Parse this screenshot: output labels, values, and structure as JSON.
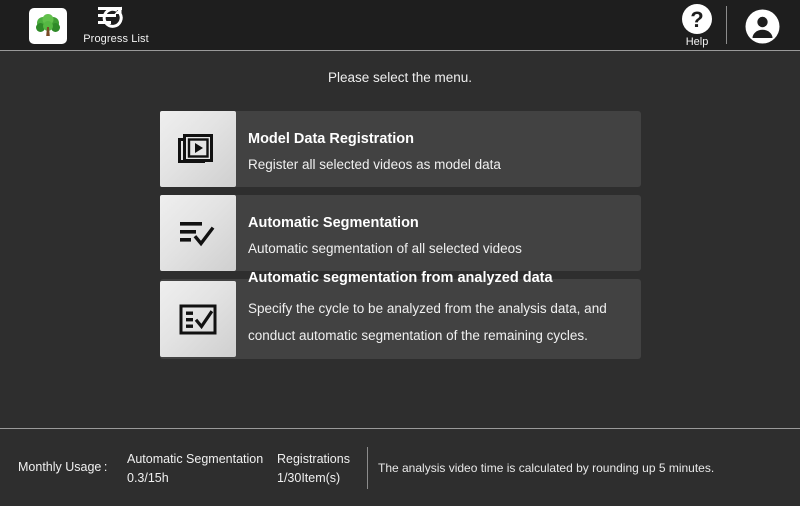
{
  "header": {
    "logo_icon": "tree-logo-icon",
    "progress_list": {
      "label": "Progress List",
      "icon": "progress-list-icon"
    },
    "help": {
      "label": "Help",
      "icon": "help-question-icon"
    },
    "account": {
      "icon": "user-account-icon"
    }
  },
  "main": {
    "prompt": "Please select the menu.",
    "menu_items": [
      {
        "icon": "video-stack-play-icon",
        "title": "Model Data Registration",
        "description": "Register all selected videos as model data"
      },
      {
        "icon": "list-check-icon",
        "title": "Automatic Segmentation",
        "description": "Automatic segmentation of all selected videos"
      },
      {
        "icon": "checklist-box-icon",
        "title": "Automatic segmentation from analyzed data",
        "description": "Specify the cycle to be analyzed from the analysis data, and conduct automatic segmentation of the remaining cycles."
      }
    ]
  },
  "footer": {
    "usage_label": "Monthly Usage :",
    "usage_items": [
      {
        "name": "Automatic Segmentation",
        "value": "0.3/15h"
      },
      {
        "name": "Registrations",
        "value": "1/30Item(s)"
      }
    ],
    "note": "The analysis video time is calculated by rounding up 5 minutes."
  },
  "colors": {
    "header_bg": "#1e1e1e",
    "body_bg": "#2e2e2e",
    "tile_bg": "#424242",
    "tile_icon_bg": "#e6e6e6",
    "text": "#f0f0f0",
    "divider": "#9a9a9a",
    "logo_green": "#3cab3c"
  }
}
